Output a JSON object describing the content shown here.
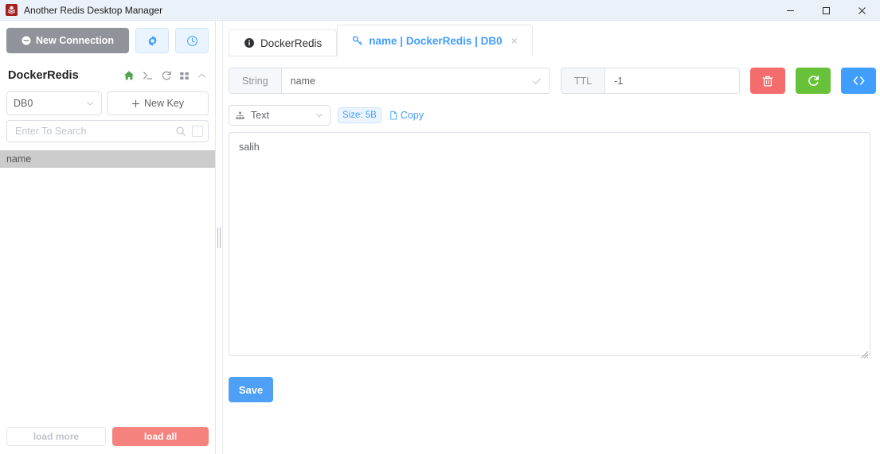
{
  "window": {
    "title": "Another Redis Desktop Manager",
    "app_icon": "redis-logo-icon",
    "controls": {
      "minimize": "—",
      "maximize": "□",
      "close": "✕"
    }
  },
  "sidebar": {
    "new_connection_label": "New Connection",
    "settings_icon": "gear-icon",
    "history_icon": "clock-icon",
    "connection_name": "DockerRedis",
    "header_icons": [
      {
        "name": "home-icon",
        "color": "#52a352"
      },
      {
        "name": "console-icon",
        "color": "#909399"
      },
      {
        "name": "refresh-icon",
        "color": "#909399"
      },
      {
        "name": "grid-icon",
        "color": "#909399"
      },
      {
        "name": "chevron-up-icon",
        "color": "#b6b9bf"
      }
    ],
    "db_selected": "DB0",
    "new_key_label": "New Key",
    "search_placeholder": "Enter To Search",
    "search_value": "",
    "keys": [
      {
        "label": "name",
        "selected": true
      }
    ],
    "load_more_label": "load more",
    "load_all_label": "load all"
  },
  "tabs": [
    {
      "label": "DockerRedis",
      "icon": "info-icon",
      "active": false,
      "closable": false
    },
    {
      "label": "name | DockerRedis | DB0",
      "icon": "key-icon",
      "active": true,
      "closable": true,
      "close_label": "×"
    }
  ],
  "editor": {
    "key_type_label": "String",
    "key_name": "name",
    "key_confirm_icon": "check-icon",
    "ttl_label": "TTL",
    "ttl_value": "-1",
    "ttl_clear_icon": "close-icon",
    "ttl_confirm_icon": "check-icon",
    "actions": [
      {
        "name": "delete-key-button",
        "icon": "trash-icon",
        "color": "#f56c6c"
      },
      {
        "name": "refresh-key-button",
        "icon": "refresh-icon",
        "color": "#67c23a"
      },
      {
        "name": "code-view-button",
        "icon": "code-icon",
        "color": "#409eff"
      }
    ],
    "format_icon": "hierarchy-icon",
    "format_selected": "Text",
    "size_badge": "Size: 5B",
    "copy_label": "Copy",
    "copy_icon": "document-copy-icon",
    "value": "salih",
    "save_label": "Save"
  },
  "colors": {
    "titlebar_bg": "#eaf1f8",
    "accent_blue": "#409eff",
    "danger_red": "#f56c6c",
    "success_green": "#67c23a",
    "load_all_red": "#f5827d",
    "selected_key_bg": "#cccccc"
  }
}
